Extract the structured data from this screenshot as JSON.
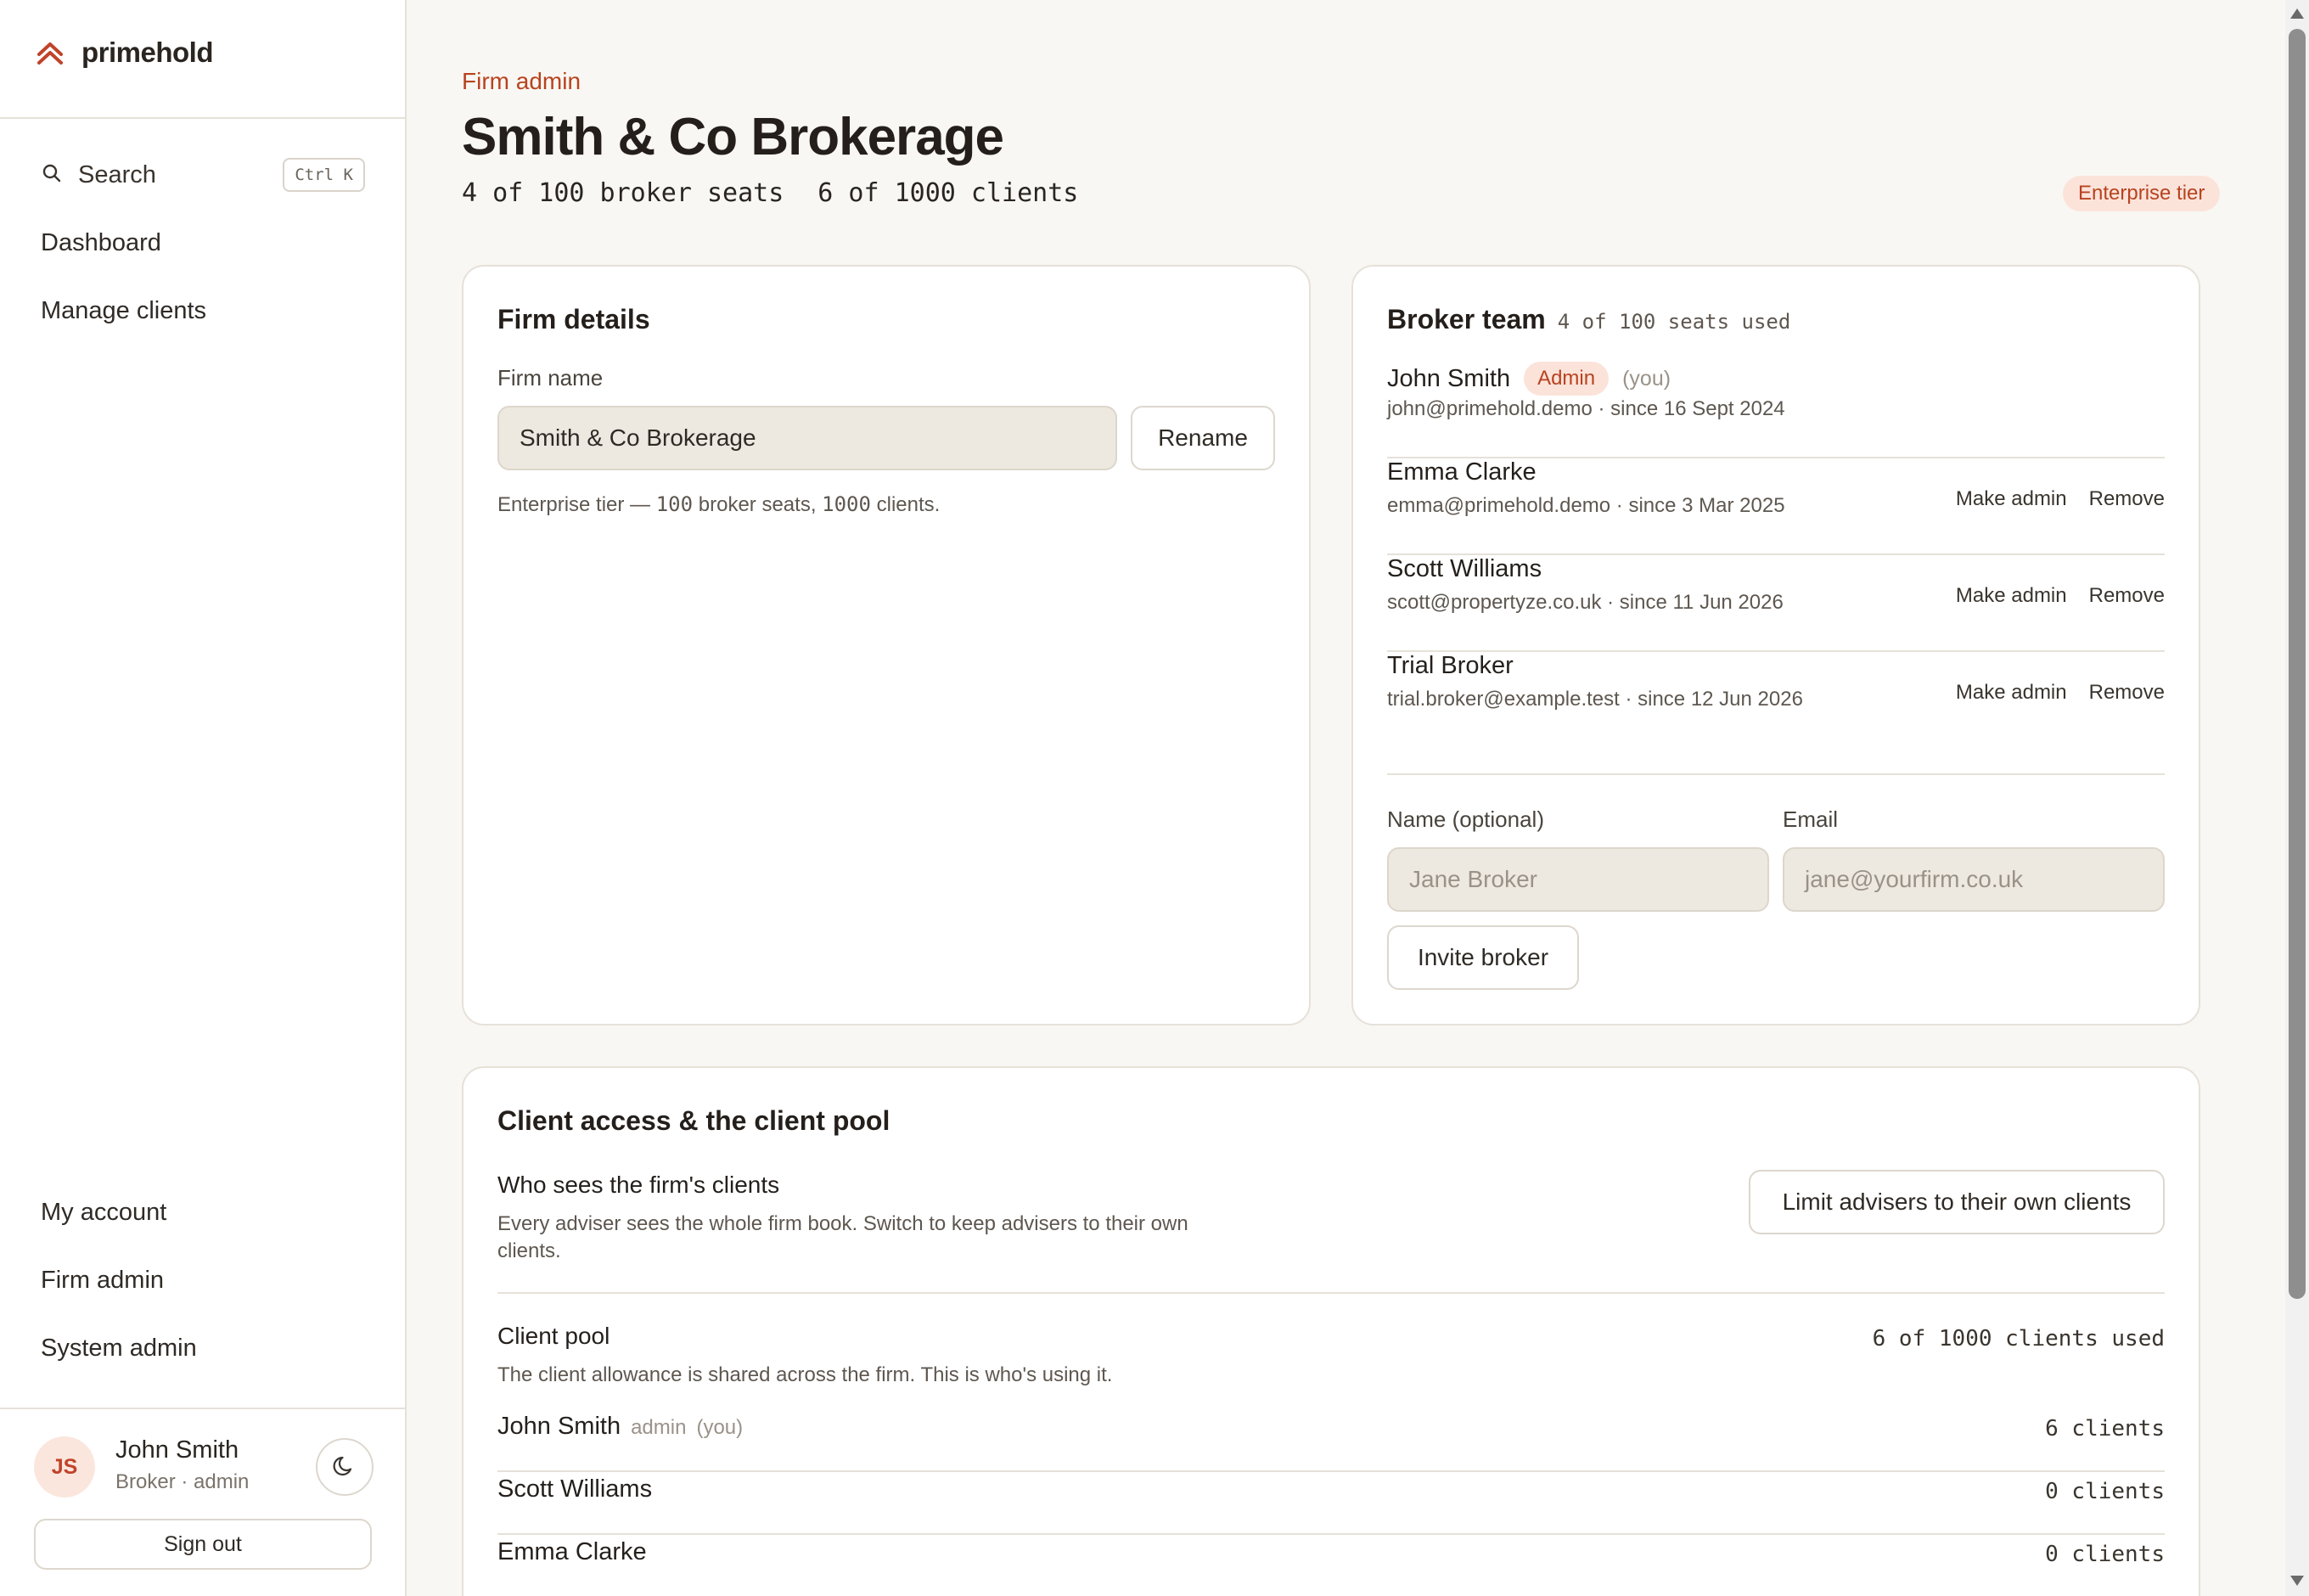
{
  "app": {
    "name": "primehold",
    "brand_color": "#c0432a"
  },
  "sidebar": {
    "search": {
      "label": "Search",
      "shortcut": "Ctrl K"
    },
    "nav_top": [
      {
        "label": "Dashboard"
      },
      {
        "label": "Manage clients"
      }
    ],
    "nav_bottom": [
      {
        "label": "My account"
      },
      {
        "label": "Firm admin"
      },
      {
        "label": "System admin"
      }
    ],
    "user": {
      "initials": "JS",
      "name": "John Smith",
      "role": "Broker · admin"
    },
    "sign_out_label": "Sign out"
  },
  "header": {
    "eyebrow": "Firm admin",
    "title": "Smith & Co Brokerage",
    "seats_stat": "4 of 100 broker seats",
    "clients_stat": "6 of 1000 clients",
    "tier_badge": "Enterprise tier"
  },
  "firm_details": {
    "title": "Firm details",
    "name_label": "Firm name",
    "name_value": "Smith & Co Brokerage",
    "rename_label": "Rename",
    "hint_prefix": "Enterprise tier — ",
    "hint_seats": "100",
    "hint_middle": " broker seats, ",
    "hint_clients": "1000",
    "hint_suffix": " clients."
  },
  "broker_team": {
    "title": "Broker team",
    "seats_used": "4 of 100 seats used",
    "members": [
      {
        "name": "John Smith",
        "badge": "Admin",
        "you": "(you)",
        "meta": "john@primehold.demo · since 16 Sept 2024"
      },
      {
        "name": "Emma Clarke",
        "meta": "emma@primehold.demo · since 3 Mar 2025",
        "make_admin": "Make admin",
        "remove": "Remove"
      },
      {
        "name": "Scott Williams",
        "meta": "scott@propertyze.co.uk · since 11 Jun 2026",
        "make_admin": "Make admin",
        "remove": "Remove"
      },
      {
        "name": "Trial Broker",
        "meta": "trial.broker@example.test · since 12 Jun 2026",
        "make_admin": "Make admin",
        "remove": "Remove"
      }
    ],
    "invite": {
      "name_label": "Name (optional)",
      "name_placeholder": "Jane Broker",
      "email_label": "Email",
      "email_placeholder": "jane@yourfirm.co.uk",
      "button_label": "Invite broker"
    }
  },
  "client_access": {
    "title": "Client access & the client pool",
    "visibility": {
      "heading": "Who sees the firm's clients",
      "description": "Every adviser sees the whole firm book. Switch to keep advisers to their own clients.",
      "button_label": "Limit advisers to their own clients"
    },
    "pool": {
      "heading": "Client pool",
      "description": "The client allowance is shared across the firm. This is who's using it.",
      "used": "6 of 1000 clients used",
      "rows": [
        {
          "name": "John Smith",
          "tag": "admin",
          "you": "(you)",
          "count": "6 clients"
        },
        {
          "name": "Scott Williams",
          "count": "0 clients"
        },
        {
          "name": "Emma Clarke",
          "count": "0 clients"
        }
      ]
    }
  }
}
